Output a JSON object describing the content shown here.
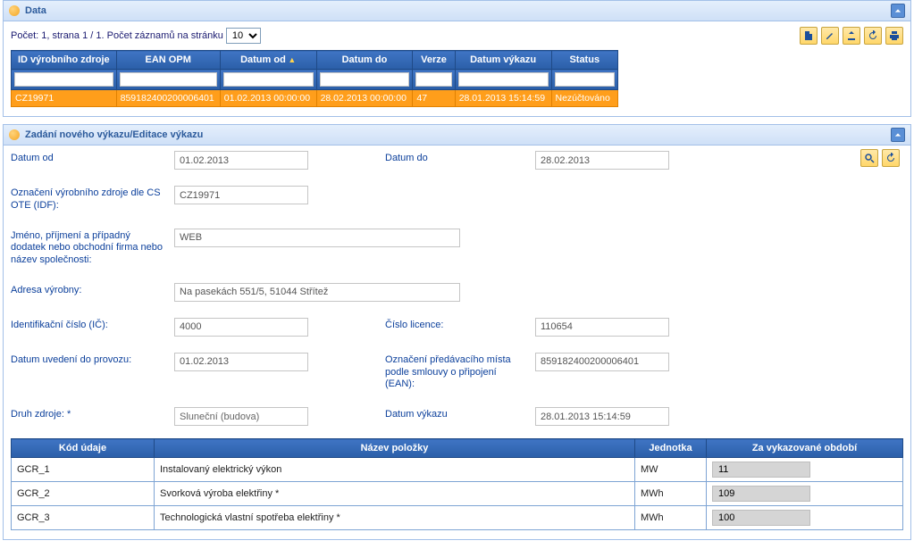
{
  "panel_data": {
    "title": "Data",
    "pager_text": "Počet: 1, strana 1 / 1. Počet záznamů na stránku",
    "page_size": "10",
    "columns": {
      "id": "ID výrobního zdroje",
      "ean": "EAN OPM",
      "datum_od": "Datum od",
      "datum_do": "Datum do",
      "verze": "Verze",
      "datum_vykazu": "Datum výkazu",
      "status": "Status"
    },
    "row": {
      "id": "CZ19971",
      "ean": "859182400200006401",
      "datum_od": "01.02.2013 00:00:00",
      "datum_do": "28.02.2013 00:00:00",
      "verze": "47",
      "datum_vykazu": "28.01.2013 15:14:59",
      "status": "Nezúčtováno"
    }
  },
  "panel_form": {
    "title": "Zadání nového výkazu/Editace výkazu",
    "labels": {
      "datum_od": "Datum od",
      "datum_do": "Datum do",
      "oznaceni_zdroje": "Označení výrobního zdroje dle CS OTE (IDF):",
      "jmeno": "Jméno, příjmení a případný dodatek nebo obchodní firma nebo název společnosti:",
      "adresa": "Adresa výrobny:",
      "ic": "Identifikační číslo (IČ):",
      "cislo_licence": "Číslo licence:",
      "datum_uvedeni": "Datum uvedení do provozu:",
      "oznaceni_mista": "Označení předávacího místa podle smlouvy o připojení (EAN):",
      "druh_zdroje": "Druh zdroje: *",
      "datum_vykazu": "Datum výkazu"
    },
    "values": {
      "datum_od": "01.02.2013",
      "datum_do": "28.02.2013",
      "oznaceni_zdroje": "CZ19971",
      "jmeno": "WEB",
      "adresa": "Na pasekách 551/5, 51044 Střítež",
      "ic": "4000",
      "cislo_licence": "110654",
      "datum_uvedeni": "01.02.2013",
      "oznaceni_mista": "859182400200006401",
      "druh_zdroje": "Sluneční (budova)",
      "datum_vykazu": "28.01.2013 15:14:59"
    },
    "items_headers": {
      "kod": "Kód údaje",
      "nazev": "Název položky",
      "jednotka": "Jednotka",
      "obdobi": "Za vykazované období"
    },
    "items": [
      {
        "kod": "GCR_1",
        "nazev": "Instalovaný elektrický výkon",
        "jednotka": "MW",
        "hodnota": "11"
      },
      {
        "kod": "GCR_2",
        "nazev": "Svorková výroba elektřiny *",
        "jednotka": "MWh",
        "hodnota": "109"
      },
      {
        "kod": "GCR_3",
        "nazev": "Technologická vlastní spotřeba elektřiny *",
        "jednotka": "MWh",
        "hodnota": "100"
      }
    ]
  }
}
